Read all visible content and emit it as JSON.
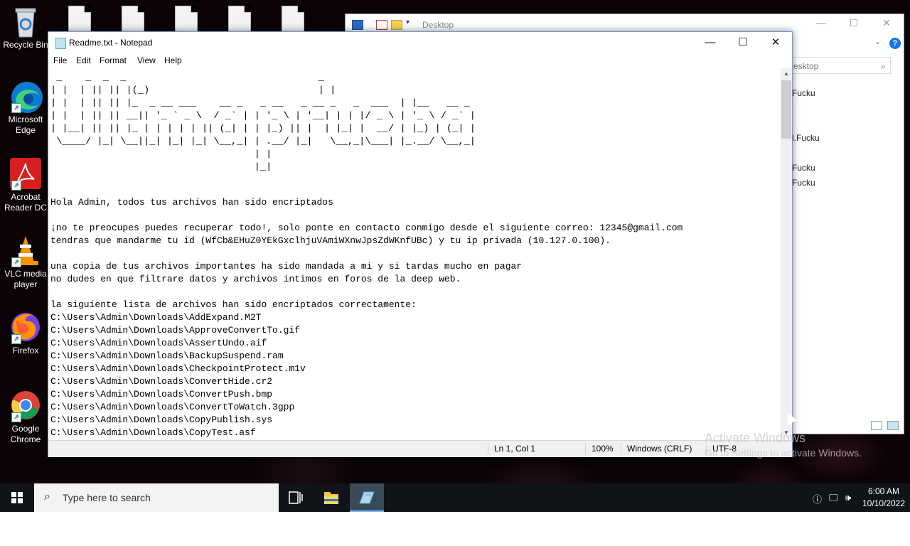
{
  "desktop": {
    "icons": [
      {
        "label": "Recycle Bin"
      },
      {
        "label": "Microsoft Edge"
      },
      {
        "label": "Acrobat Reader DC"
      },
      {
        "label": "VLC media player"
      },
      {
        "label": "Firefox"
      },
      {
        "label": "Google Chrome"
      }
    ]
  },
  "explorer": {
    "title": "Desktop",
    "search_placeholder": "Search Desktop",
    "search_visible": "esktop",
    "items": [
      "Fucku",
      "l.Fucku",
      "Fucku",
      "Fucku"
    ]
  },
  "notepad": {
    "title": "Readme.txt - Notepad",
    "menu": [
      "File",
      "Edit",
      "Format",
      "View",
      "Help"
    ],
    "ascii_art": " _    _  _  _                                 _          \n| |  | || || |(_)                             | |         \n| |  | || || |_  _ __ ___    __ _   _ __   _ __ _   _  ___  | |__   __ _ \n| |  | || || __|| '_ ` _ \\  / _` | | '_ \\ | '__| | | |/ _ \\ | '_ \\ / _` |\n| |__| || || |_ | | | | | || (_| | | |_) || |  | |_| |  __/ | |_) | (_| |\n \\____/ |_| \\__||_| |_| |_| \\__,_| | .__/ |_|   \\__,_|\\___| |_.__/ \\__,_|\n                                   | |                                  \n                                   |_|                                  ",
    "lines": [
      "Hola Admin, todos tus archivos han sido encriptados",
      "",
      "¡no te preocupes puedes recuperar todo!, solo ponte en contacto conmigo desde el siguiente correo: 12345@gmail.com",
      "tendras que mandarme tu id (WfCb&EHuZ0YEkGxclhjuVAmiWXnwJpsZdWKnfUBc) y tu ip privada (10.127.0.100).",
      "",
      "una copia de tus archivos importantes ha sido mandada a mi y si tardas mucho en pagar",
      "no dudes en que filtrare datos y archivos intimos en foros de la deep web.",
      "",
      "la siguiente lista de archivos han sido encriptados correctamente:",
      "C:\\Users\\Admin\\Downloads\\AddExpand.M2T",
      "C:\\Users\\Admin\\Downloads\\ApproveConvertTo.gif",
      "C:\\Users\\Admin\\Downloads\\AssertUndo.aif",
      "C:\\Users\\Admin\\Downloads\\BackupSuspend.ram",
      "C:\\Users\\Admin\\Downloads\\CheckpointProtect.m1v",
      "C:\\Users\\Admin\\Downloads\\ConvertHide.cr2",
      "C:\\Users\\Admin\\Downloads\\ConvertPush.bmp",
      "C:\\Users\\Admin\\Downloads\\ConvertToWatch.3gpp",
      "C:\\Users\\Admin\\Downloads\\CopyPublish.sys",
      "C:\\Users\\Admin\\Downloads\\CopyTest.asf"
    ],
    "status": {
      "position": "Ln 1, Col 1",
      "zoom": "100%",
      "line_ending": "Windows (CRLF)",
      "encoding": "UTF-8"
    }
  },
  "watermark": {
    "line1": "Activate Windows",
    "line2": "Go to Settings to activate Windows."
  },
  "taskbar": {
    "search_placeholder": "Type here to search",
    "time": "6:00 AM",
    "date": "10/10/2022"
  }
}
